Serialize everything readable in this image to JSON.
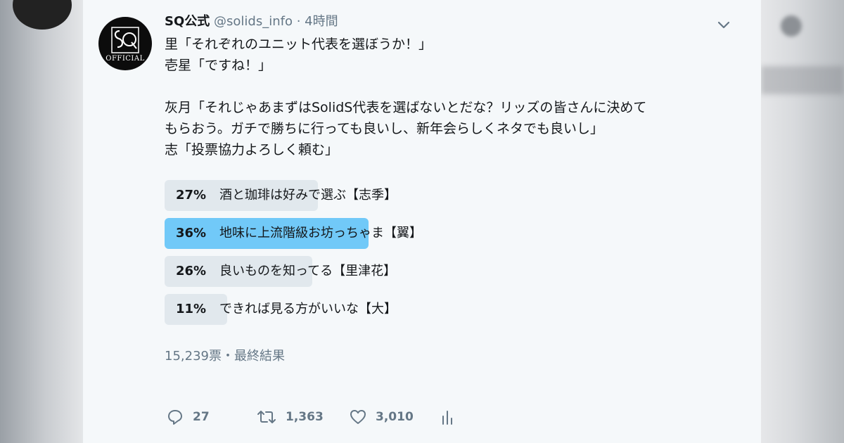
{
  "tweet": {
    "name": "SQ公式",
    "handle": "@solids_info",
    "separator": "·",
    "time": "4時間",
    "avatar": {
      "logo_text": "OFFICIAL"
    },
    "text_lines": [
      "里「それぞれのユニット代表を選ぼうか！」",
      "壱星「ですね！」",
      "",
      "灰月「それじゃあまずはSolidS代表を選ばないとだな？リッズの皆さんに決めて",
      "もらおう。ガチで勝ちに行っても良いし、新年会らしくネタでも良いし」",
      "志「投票協力よろしく頼む」"
    ]
  },
  "poll": {
    "options": [
      {
        "percent": "27%",
        "label": "酒と珈琲は好みで選ぶ【志季】",
        "value": 27,
        "winner": false
      },
      {
        "percent": "36%",
        "label": "地味に上流階級お坊っちゃま【翼】",
        "value": 36,
        "winner": true
      },
      {
        "percent": "26%",
        "label": "良いものを知ってる【里津花】",
        "value": 26,
        "winner": false
      },
      {
        "percent": "11%",
        "label": "できれば見る方がいいな【大】",
        "value": 11,
        "winner": false
      }
    ],
    "summary": "15,239票・最終結果"
  },
  "actions": {
    "reply": {
      "icon": "reply-icon",
      "count": "27"
    },
    "retweet": {
      "icon": "retweet-icon",
      "count": "1,363"
    },
    "like": {
      "icon": "heart-icon",
      "count": "3,010"
    },
    "analytics": {
      "icon": "analytics-icon"
    }
  },
  "colors": {
    "winner_fill": "#71c9f8",
    "option_fill": "#e1e8ed",
    "muted": "#657786",
    "text": "#14171a"
  }
}
